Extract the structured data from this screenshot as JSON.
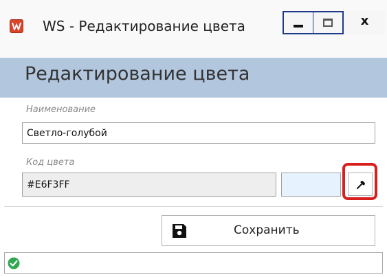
{
  "window": {
    "title": "WS - Редактирование цвета",
    "app_icon_letter": "W",
    "close_glyph": "x"
  },
  "header": {
    "title": "Редактирование цвета"
  },
  "form": {
    "name_label": "Наименование",
    "name_value": "Светло-голубой",
    "code_label": "Код цвета",
    "code_value": "#E6F3FF",
    "preview_color": "#E6F3FF",
    "picker_icon": "eyedropper-icon"
  },
  "actions": {
    "save_label": "Сохранить",
    "save_icon": "floppy-disk-icon"
  },
  "status": {
    "icon": "check-circle-icon",
    "icon_color": "#2fa84f"
  }
}
